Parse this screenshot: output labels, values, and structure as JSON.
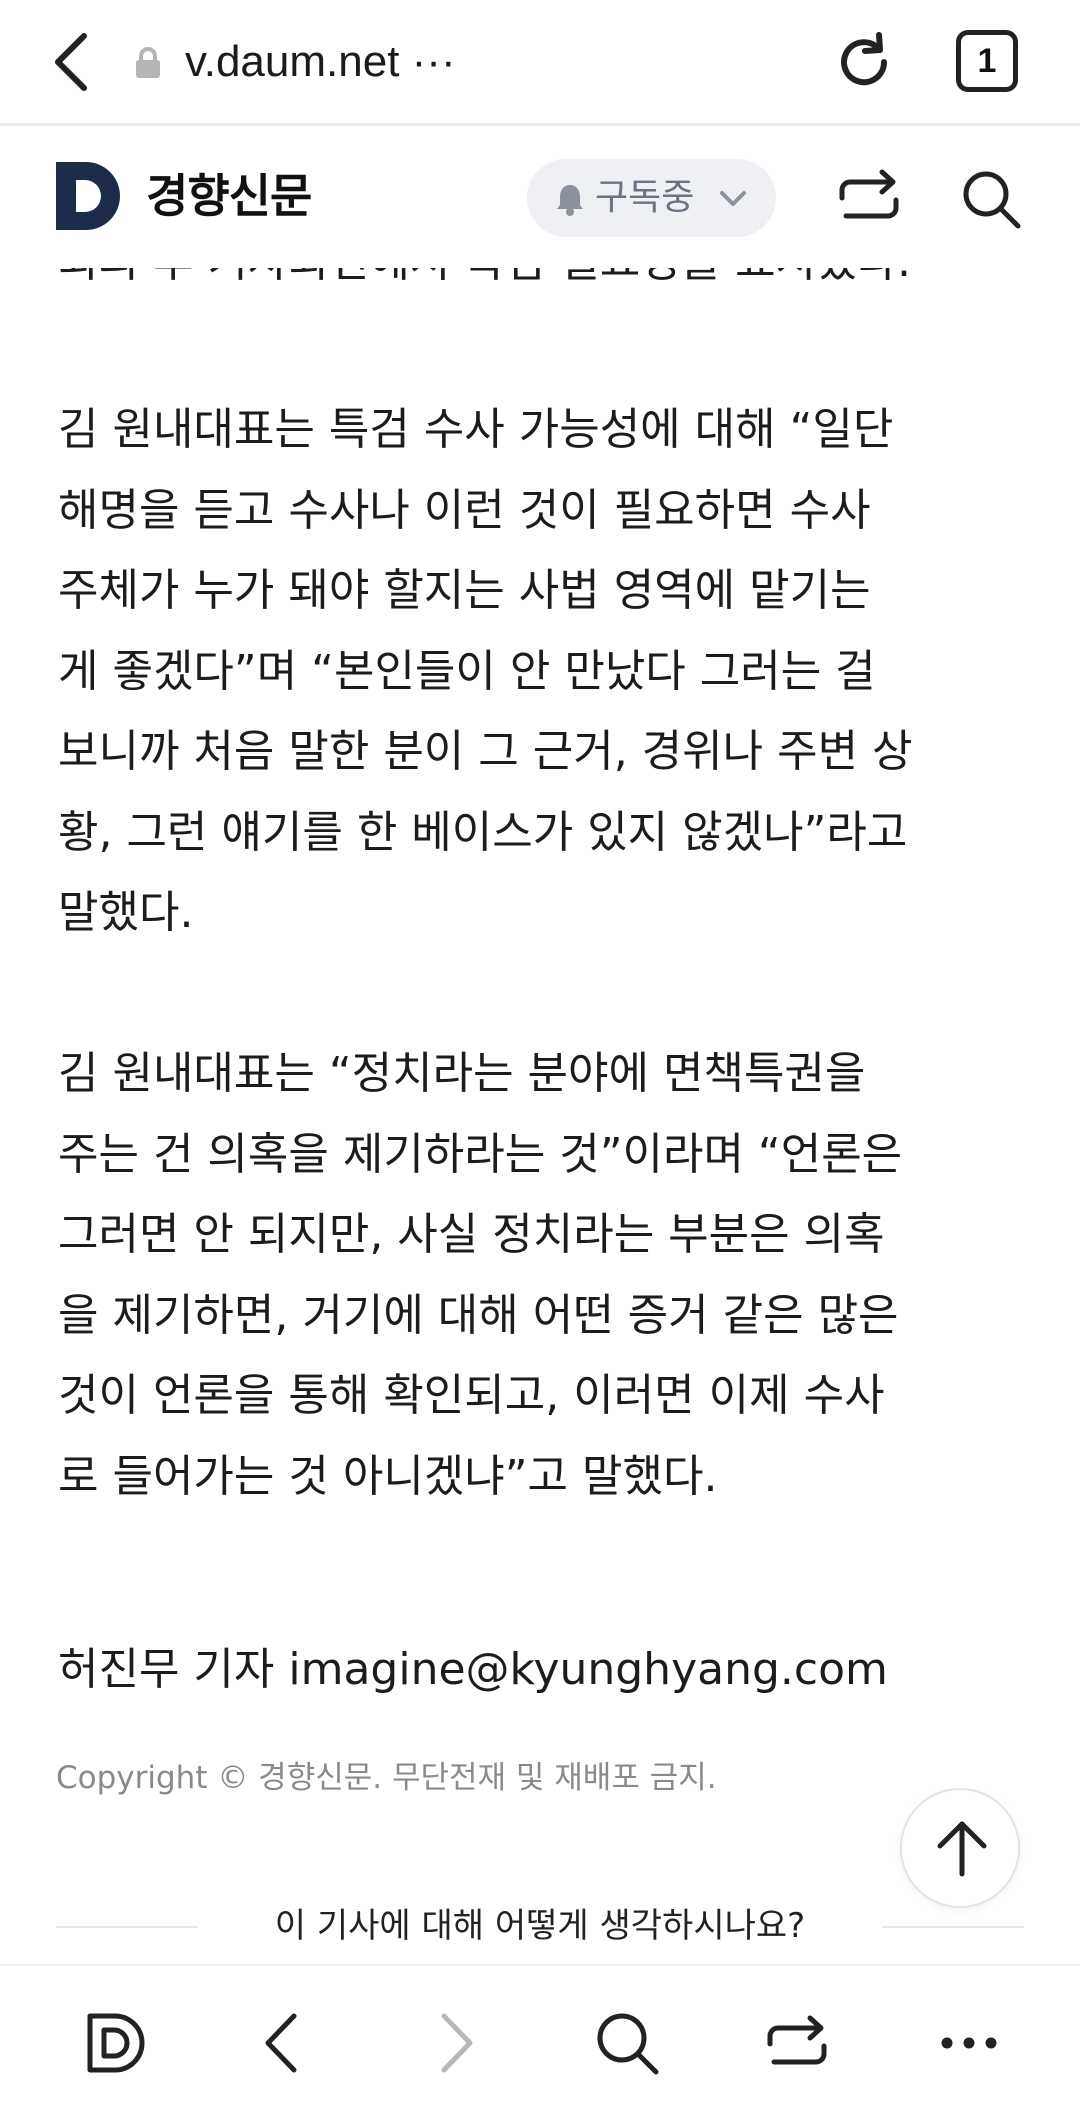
{
  "browser": {
    "url": "v.daum.net ···",
    "tab_count": "1",
    "icons": [
      "back-icon",
      "lock-icon",
      "reload-icon",
      "tabs-icon"
    ]
  },
  "site": {
    "name": "경향신문",
    "subscribe_label": "구독중",
    "icons": [
      "daum-logo",
      "bell-icon",
      "chevron-down-icon",
      "share-icon",
      "search-icon"
    ]
  },
  "article": {
    "cut_line": "회의 후 기자회견에서 특검 필요성을 표시했다.",
    "paragraph1": [
      "김 원내대표는 특검 수사 가능성에 대해 “일단",
      "해명을 듣고 수사나 이런 것이 필요하면 수사",
      "주체가 누가 돼야 할지는 사법 영역에 맡기는",
      "게 좋겠다”며 “본인들이 안 만났다 그러는 걸",
      "보니까 처음 말한 분이 그 근거, 경위나 주변 상",
      "황, 그런 얘기를 한 베이스가 있지 않겠나”라고",
      "말했다."
    ],
    "paragraph2": [
      "김 원내대표는 “정치라는 분야에 면책특권을",
      "주는 건 의혹을 제기하라는 것”이라며 “언론은",
      "그러면 안 되지만, 사실 정치라는 부분은 의혹",
      "을 제기하면, 거기에 대해 어떤 증거 같은 많은",
      "것이 언론을 통해 확인되고, 이러면 이제 수사",
      "로 들어가는 것 아니겠냐”고 말했다."
    ],
    "byline": "허진무 기자 imagine@kyunghyang.com",
    "copyright": "Copyright © 경향신문. 무단전재 및 재배포 금지.",
    "reaction_question": "이 기사에 대해 어떻게 생각하시나요?"
  },
  "bottom_nav": {
    "icons": [
      "daum-home-icon",
      "back-arrow-icon",
      "forward-arrow-icon",
      "search-icon",
      "share-icon",
      "more-icon"
    ]
  },
  "colors": {
    "logo_navy": "#1c2b4a",
    "pill_bg": "#eef0f4",
    "pill_text": "#6b7280",
    "copyright_text": "#8a8a8a"
  }
}
